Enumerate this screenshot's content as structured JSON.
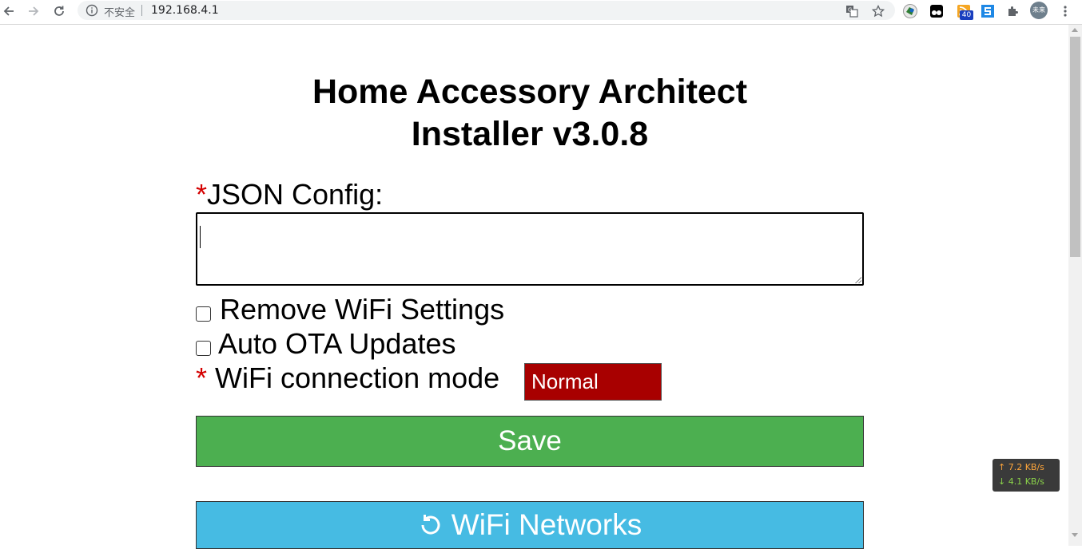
{
  "browser": {
    "security_label": "不安全",
    "url": "192.168.4.1",
    "extension_badge_count": "40",
    "profile_avatar_text": "未来"
  },
  "page": {
    "title_line1": "Home Accessory Architect",
    "title_line2": "Installer v3.0.8",
    "required_marker": "*",
    "json_config_label": "JSON Config:",
    "json_config_value": "",
    "remove_wifi_label": "Remove WiFi Settings",
    "remove_wifi_checked": false,
    "auto_ota_label": "Auto OTA Updates",
    "auto_ota_checked": false,
    "wifi_mode_label": "WiFi connection mode",
    "wifi_mode_value": "Normal",
    "save_button": "Save",
    "wifi_networks_button": "WiFi Networks"
  },
  "network_monitor": {
    "upload": "↑ 7.2 KB/s",
    "download": "↓ 4.1 KB/s"
  },
  "colors": {
    "select_bg": "#a80000",
    "save_bg": "#4caf50",
    "wifi_bg": "#46bbe3",
    "required": "#d40000"
  }
}
